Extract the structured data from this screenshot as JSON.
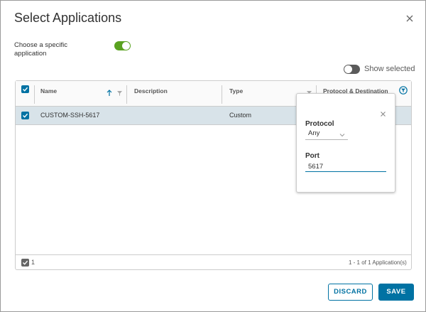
{
  "dialog": {
    "title": "Select Applications"
  },
  "options": {
    "choose_specific_label": "Choose a specific application",
    "choose_specific_on": true,
    "show_selected_label": "Show selected",
    "show_selected_on": false
  },
  "grid": {
    "columns": [
      {
        "label": "Name"
      },
      {
        "label": "Description"
      },
      {
        "label": "Type"
      },
      {
        "label": "Protocol & Destination"
      }
    ],
    "rows": [
      {
        "name": "CUSTOM-SSH-5617",
        "description": "",
        "type": "Custom",
        "selected": true
      }
    ],
    "footer": {
      "selected_count": "1",
      "range_text": "1 - 1 of 1 Application(s)"
    }
  },
  "filter_popover": {
    "protocol_label": "Protocol",
    "protocol_value": "Any",
    "port_label": "Port",
    "port_value": "5617"
  },
  "actions": {
    "discard_label": "DISCARD",
    "save_label": "SAVE"
  },
  "colors": {
    "accent": "#0072a3",
    "toggle_on": "#5aa220",
    "row_selected": "#d8e3e9"
  },
  "icons": {
    "close": "close-icon",
    "sort": "sort-ascending-icon",
    "filter": "filter-icon",
    "checkbox": "checkbox-checked-icon",
    "dropdown": "chevron-down-icon"
  }
}
